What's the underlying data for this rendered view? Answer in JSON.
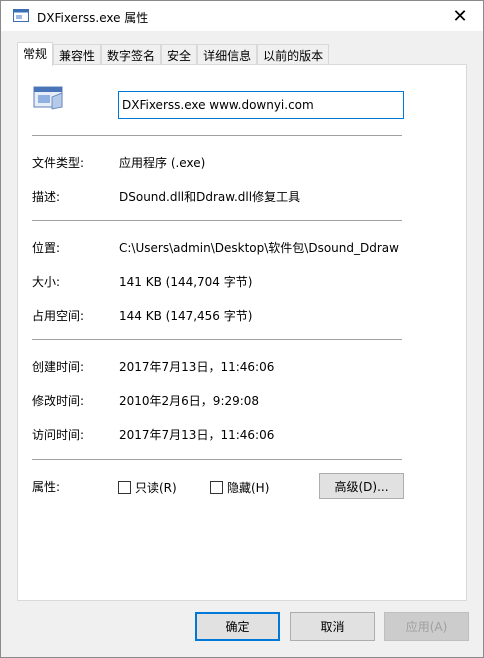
{
  "window": {
    "title": "DXFixerss.exe 属性",
    "close_glyph": "✕"
  },
  "tabs": [
    {
      "label": "常规",
      "active": true
    },
    {
      "label": "兼容性"
    },
    {
      "label": "数字签名"
    },
    {
      "label": "安全"
    },
    {
      "label": "详细信息"
    },
    {
      "label": "以前的版本"
    }
  ],
  "general": {
    "file_name": "DXFixerss.exe www.downyi.com",
    "file_type_label": "文件类型:",
    "file_type_value": "应用程序 (.exe)",
    "description_label": "描述:",
    "description_value": "DSound.dll和Ddraw.dll修复工具",
    "location_label": "位置:",
    "location_value": "C:\\Users\\admin\\Desktop\\软件包\\Dsound_Ddraw",
    "size_label": "大小:",
    "size_value": "141 KB (144,704 字节)",
    "size_on_disk_label": "占用空间:",
    "size_on_disk_value": "144 KB (147,456 字节)",
    "created_label": "创建时间:",
    "created_value": "2017年7月13日，11:46:06",
    "modified_label": "修改时间:",
    "modified_value": "2010年2月6日，9:29:08",
    "accessed_label": "访问时间:",
    "accessed_value": "2017年7月13日，11:46:06",
    "attributes_label": "属性:",
    "readonly_label": "只读(R)",
    "hidden_label": "隐藏(H)",
    "advanced_label": "高级(D)..."
  },
  "buttons": {
    "ok": "确定",
    "cancel": "取消",
    "apply": "应用(A)"
  },
  "icons": {
    "title": "application-window-icon",
    "file": "application-window-icon",
    "close": "close-icon"
  },
  "colors": {
    "accent": "#0078d7",
    "panel_bg": "#ffffff",
    "window_bg": "#f0f0f0"
  }
}
